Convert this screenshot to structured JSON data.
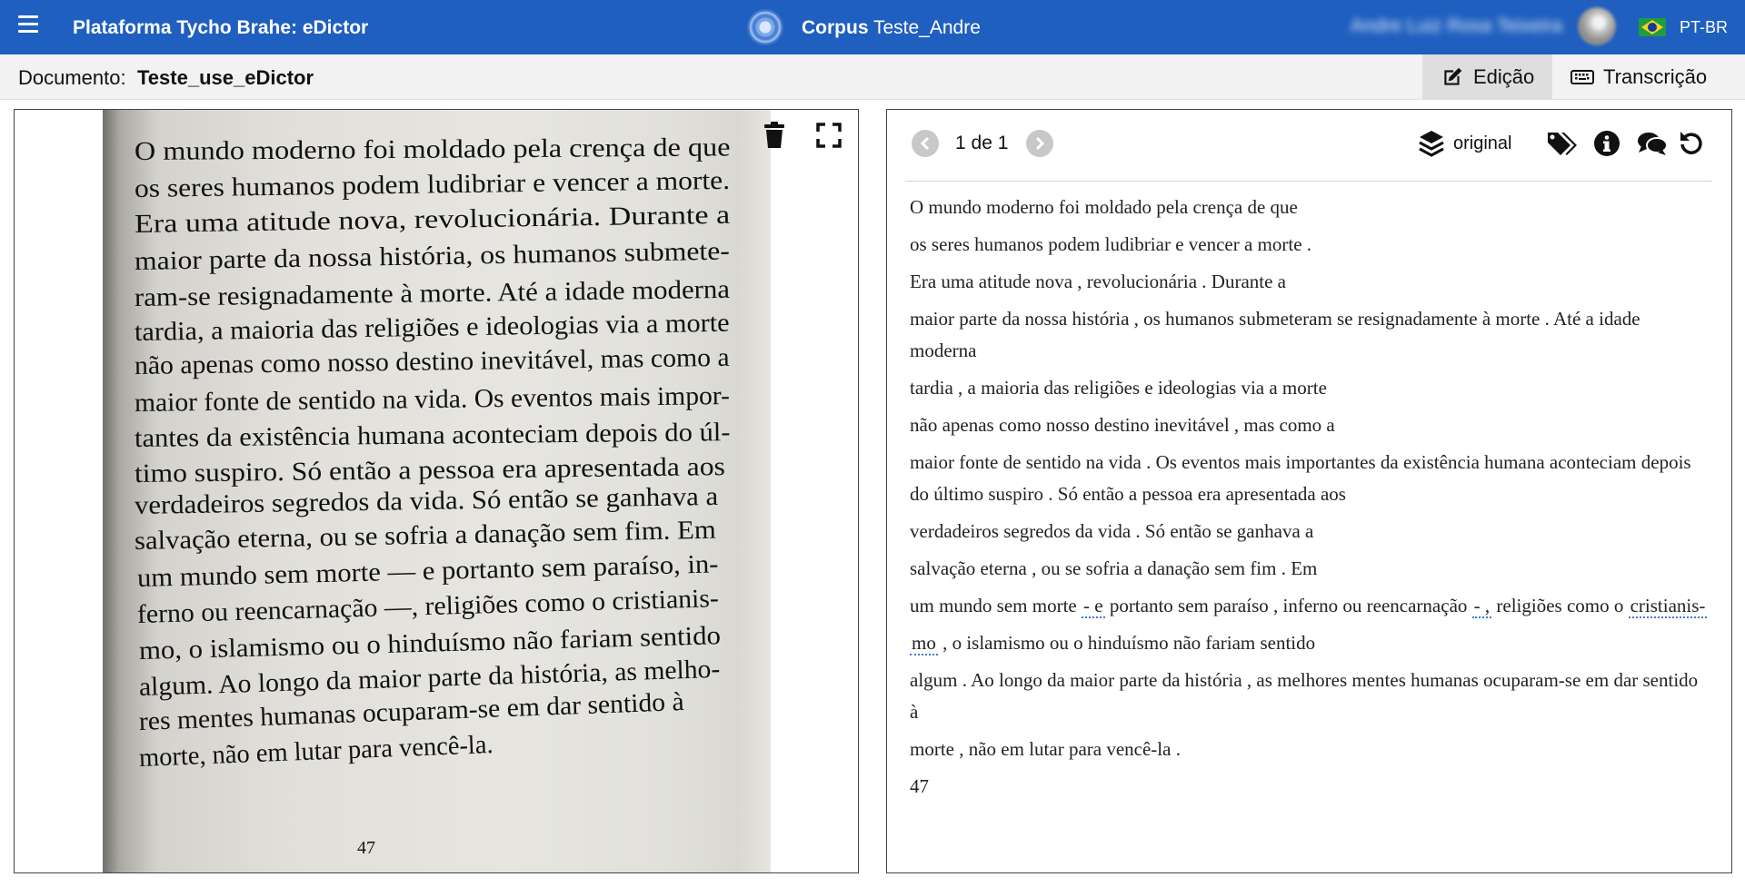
{
  "topbar": {
    "app_title": "Plataforma Tycho Brahe: eDictor",
    "corpus_label": "Corpus",
    "corpus_name": "Teste_Andre",
    "user_name": "Andre Luiz Rosa Teixeira",
    "language": "PT-BR"
  },
  "docbar": {
    "document_label": "Documento:",
    "document_name": "Teste_use_eDictor",
    "tabs": [
      {
        "label": "Edição",
        "icon": "edit-icon",
        "active": true
      },
      {
        "label": "Transcrição",
        "icon": "keyboard-icon",
        "active": false
      }
    ]
  },
  "image_panel": {
    "scan_lines": [
      "O mundo moderno foi moldado pela crença de que",
      "os seres humanos podem ludibriar e vencer a morte.",
      "Era uma atitude nova, revolucionária. Durante a",
      "maior parte da nossa história, os humanos submete-",
      "ram-se resignadamente à morte. Até a idade moderna",
      "tardia, a maioria das religiões e ideologias via a morte",
      "não apenas como nosso destino inevitável, mas como a",
      "maior fonte de sentido na vida. Os eventos mais impor-",
      "tantes da existência humana aconteciam depois do úl-",
      "timo suspiro. Só então a pessoa era apresentada aos",
      "verdadeiros segredos da vida. Só então se ganhava a",
      "salvação eterna, ou se sofria a danação sem fim. Em",
      "um mundo sem morte — e portanto sem paraíso, in-",
      "ferno ou reencarnação —, religiões como o cristianis-",
      "mo, o islamismo ou o hinduísmo não fariam sentido",
      "algum. Ao longo da maior parte da história, as melho-",
      "res mentes humanas ocuparam-se em dar sentido à",
      "morte, não em lutar para vencê-la."
    ],
    "page_number": "47",
    "icons": [
      "trash-icon",
      "fullscreen-icon"
    ]
  },
  "transcription_panel": {
    "page_indicator": "1 de 1",
    "version_label": "original",
    "icons": [
      "layers-icon",
      "tags-icon",
      "info-icon",
      "comments-icon",
      "undo-icon"
    ],
    "lines": [
      [
        {
          "t": "O mundo moderno foi moldado pela crença de que"
        }
      ],
      [
        {
          "t": "os seres humanos podem ludibriar e vencer a morte ."
        }
      ],
      [
        {
          "t": "Era uma atitude nova , revolucionária . Durante a"
        }
      ],
      [
        {
          "t": "maior parte da nossa história , os humanos submeteram se resignadamente à morte . Até a idade moderna"
        }
      ],
      [
        {
          "t": "tardia , a maioria das religiões e ideologias via a morte"
        }
      ],
      [
        {
          "t": "não apenas como nosso destino inevitável , mas como a"
        }
      ],
      [
        {
          "t": "maior fonte de sentido na vida . Os eventos mais importantes da existência humana aconteciam depois do último suspiro . Só então a pessoa era apresentada aos"
        }
      ],
      [
        {
          "t": "verdadeiros segredos da vida . Só então se ganhava a"
        }
      ],
      [
        {
          "t": "salvação eterna , ou se sofria a danação sem fim . Em"
        }
      ],
      [
        {
          "t": "um mundo sem morte "
        },
        {
          "t": "- e",
          "edit": true
        },
        {
          "t": " portanto sem paraíso , inferno ou reencarnação "
        },
        {
          "t": "- ,",
          "edit": true
        },
        {
          "t": " religiões como o "
        },
        {
          "t": "cristianis-",
          "edit": true
        }
      ],
      [
        {
          "t": "mo",
          "edit": true
        },
        {
          "t": " , o islamismo ou o hinduísmo não fariam sentido"
        }
      ],
      [
        {
          "t": "algum . Ao longo da maior parte da história , as melhores mentes humanas ocuparam-se em dar sentido à"
        }
      ],
      [
        {
          "t": "morte , não em lutar para vencê-la ."
        }
      ],
      [
        {
          "t": "47"
        }
      ]
    ]
  },
  "colors": {
    "topbar": "#1f5fbf",
    "docbar": "#f2f2f2",
    "active_tab": "#dedede",
    "edit_underline": "#3a7bd5"
  }
}
